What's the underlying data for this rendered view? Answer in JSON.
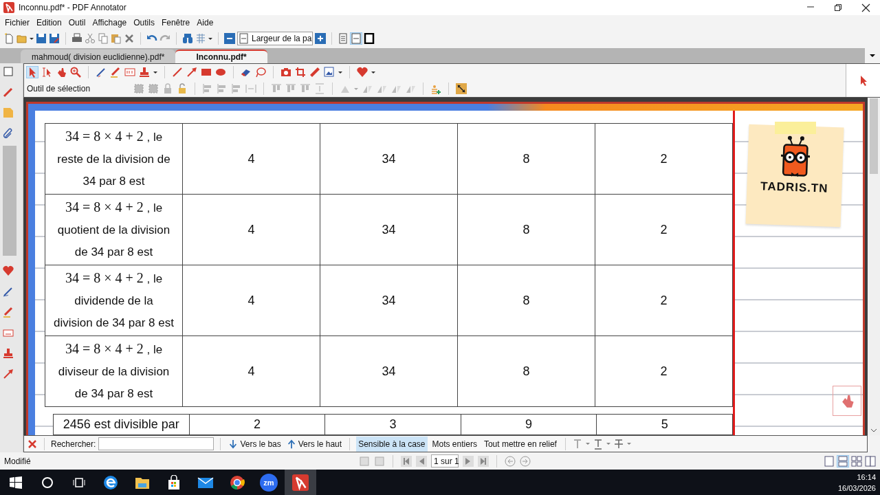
{
  "window": {
    "title": "Inconnu.pdf* - PDF Annotator"
  },
  "menu": [
    "Fichier",
    "Edition",
    "Outil",
    "Affichage",
    "Outils",
    "Fenêtre",
    "Aide"
  ],
  "toolbar": {
    "zoom_select": "Largeur de la pa"
  },
  "tabs": [
    {
      "label": "mahmoud( division euclidienne).pdf*",
      "selected": false
    },
    {
      "label": "Inconnu.pdf*",
      "selected": true
    }
  ],
  "annotation_toolbar": {
    "tool_label": "Outil de sélection"
  },
  "document": {
    "table": {
      "rows": [
        {
          "formula": "34 = 8 × 4 + 2",
          "text": ", le reste de la division de 34 par 8 est",
          "options": [
            "4",
            "34",
            "8",
            "2"
          ]
        },
        {
          "formula": "34 = 8 × 4 + 2",
          "text": ", le quotient de la division de 34 par 8 est",
          "options": [
            "4",
            "34",
            "8",
            "2"
          ]
        },
        {
          "formula": "34 = 8 × 4 + 2",
          "text": ", le dividende de la division de 34 par 8 est",
          "options": [
            "4",
            "34",
            "8",
            "2"
          ]
        },
        {
          "formula": "34 = 8 × 4 + 2",
          "text": ", le diviseur de la division de 34 par 8 est",
          "options": [
            "4",
            "34",
            "8",
            "2"
          ]
        }
      ]
    },
    "table_2": {
      "rows": [
        {
          "text": "2456 est divisible par",
          "options": [
            "2",
            "3",
            "9",
            "5"
          ]
        }
      ]
    },
    "logo": "TADRIS.TN"
  },
  "search_bar": {
    "label": "Rechercher:",
    "directions": [
      "Vers le bas",
      "Vers le haut"
    ],
    "options": [
      {
        "label": "Sensible à la case",
        "selected": true
      },
      {
        "label": "Mots entiers",
        "selected": false
      },
      {
        "label": "Tout mettre en relief",
        "selected": false
      }
    ]
  },
  "status_bar": {
    "status": "Modifié",
    "page": "1 sur 1"
  },
  "taskbar": {
    "zoom_icon_text": "zm",
    "time": "16:14",
    "date": "16/03/2026"
  }
}
